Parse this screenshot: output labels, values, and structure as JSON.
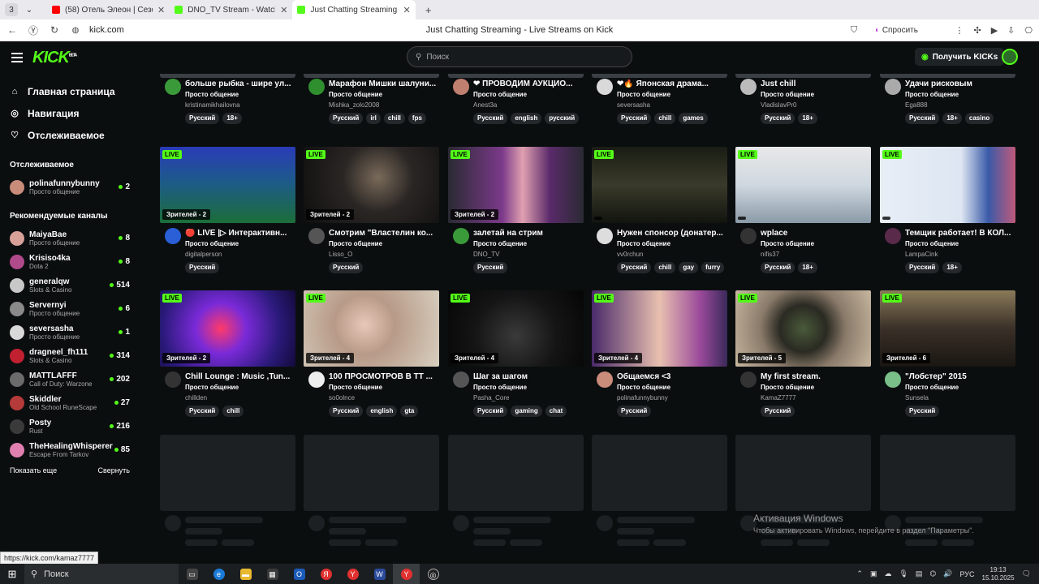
{
  "browser": {
    "tab_count": "3",
    "tabs": [
      {
        "label": "(58) Отель Элеон | Сезон",
        "fav": "#ff0000",
        "active": false
      },
      {
        "label": "DNO_TV Stream - Watch l",
        "fav": "#53fc18",
        "active": false
      },
      {
        "label": "Just Chatting Streaming",
        "fav": "#53fc18",
        "active": true
      }
    ],
    "url": "kick.com",
    "page_title": "Just Chatting Streaming - Live Streams on Kick",
    "ask_label": "Спросить"
  },
  "header": {
    "logo": "KICK",
    "logo_beta": "BETA",
    "search_placeholder": "Поиск",
    "kicks_label": "Получить KICKs"
  },
  "sidebar": {
    "nav": [
      {
        "icon": "⌂",
        "label": "Главная страница",
        "name": "home"
      },
      {
        "icon": "◎",
        "label": "Навигация",
        "name": "browse"
      },
      {
        "icon": "♡",
        "label": "Отслеживаемое",
        "name": "following"
      }
    ],
    "following_heading": "Отслеживаемое",
    "following": [
      {
        "name": "polinafunnybunny",
        "category": "Просто общение",
        "viewers": "2",
        "color": "#c98b7a"
      }
    ],
    "recommended_heading": "Рекомендуемые каналы",
    "recommended": [
      {
        "name": "MaiyaBae",
        "category": "Просто общение",
        "viewers": "8",
        "color": "#d7a19a"
      },
      {
        "name": "Krisiso4ka",
        "category": "Dota 2",
        "viewers": "8",
        "color": "#b04a8a"
      },
      {
        "name": "generalqw",
        "category": "Slots & Casino",
        "viewers": "514",
        "color": "#c8c8c8"
      },
      {
        "name": "Servernyi",
        "category": "Просто общение",
        "viewers": "6",
        "color": "#8a8a8a"
      },
      {
        "name": "seversasha",
        "category": "Просто общение",
        "viewers": "1",
        "color": "#d9d9d9"
      },
      {
        "name": "dragneel_fh111",
        "category": "Slots & Casino",
        "viewers": "314",
        "color": "#c02030"
      },
      {
        "name": "MATTLAFFF",
        "category": "Call of Duty: Warzone",
        "viewers": "202",
        "color": "#6b6b6b"
      },
      {
        "name": "Skiddler",
        "category": "Old School RuneScape",
        "viewers": "27",
        "color": "#b53a3a"
      },
      {
        "name": "Posty",
        "category": "Rust",
        "viewers": "216",
        "color": "#3a3a3a"
      },
      {
        "name": "TheHealingWhisperer",
        "category": "Escape From Tarkov",
        "viewers": "85",
        "color": "#e080b0"
      }
    ],
    "show_more": "Показать еще",
    "collapse": "Свернуть"
  },
  "top_row": [
    {
      "title": "больше рыбка - шире ул...",
      "category": "Просто общение",
      "streamer": "kristinamikhailovna",
      "tags": [
        "Русский",
        "18+"
      ],
      "av": "#3a9a3a"
    },
    {
      "title": "Марафон Мишки шалуни...",
      "category": "Просто общение",
      "streamer": "Mishka_zolo2008",
      "tags": [
        "Русский",
        "irl",
        "chill",
        "fps"
      ],
      "av": "#2f8f2f"
    },
    {
      "title": "❤ ПРОВОДИМ АУКЦИО...",
      "category": "Просто общение",
      "streamer": "Anest3a",
      "tags": [
        "Русский",
        "english",
        "русский"
      ],
      "av": "#c08070"
    },
    {
      "title": "❤🔥 Японская драма...",
      "category": "Просто общение",
      "streamer": "seversasha",
      "tags": [
        "Русский",
        "chill",
        "games"
      ],
      "av": "#d9d9d9"
    },
    {
      "title": "Just chill",
      "category": "Просто общение",
      "streamer": "VladislavPr0",
      "tags": [
        "Русский",
        "18+"
      ],
      "av": "#bbbbbb"
    },
    {
      "title": "Удачи рисковым",
      "category": "Просто общение",
      "streamer": "Ega888",
      "tags": [
        "Русский",
        "18+",
        "casino"
      ],
      "av": "#aaaaaa"
    }
  ],
  "row2": [
    {
      "title": "🔴 LIVE |▷ Интерактивн...",
      "category": "Просто общение",
      "streamer": "digitalperson",
      "tags": [
        "Русский"
      ],
      "viewers": "Зрителей - 2",
      "av": "#2a5fd8",
      "thumb": "linear-gradient(180deg,#2a3bb8 0%,#1d5a8a 45%,#1c6e3a 100%)"
    },
    {
      "title": "Смотрим \"Властелин ко...",
      "category": "Просто общение",
      "streamer": "Lisso_O",
      "tags": [
        "Русский"
      ],
      "viewers": "Зрителей - 2",
      "av": "#555555",
      "thumb": "radial-gradient(circle at 55% 40%,#7a6a5a 0%,#2a2624 40%,#0e0e0e 100%)"
    },
    {
      "title": "залетай на стрим",
      "category": "Просто общение",
      "streamer": "DNO_TV",
      "tags": [
        "Русский"
      ],
      "viewers": "Зрителей - 2",
      "av": "#3a9a3a",
      "thumb": "linear-gradient(90deg,#2a2a33 0%,#7b3a8a 40%,#e0a0b0 55%,#5a2a6a 75%,#2a2a33 100%)"
    },
    {
      "title": "Нужен спонсор (донатер...",
      "category": "Просто общение",
      "streamer": "vv0rchun",
      "tags": [
        "Русский",
        "chill",
        "gay",
        "furry"
      ],
      "av": "#dddddd",
      "thumb": "linear-gradient(180deg,#1a1d14 0%,#3a3a2a 50%,#12140f 100%)"
    },
    {
      "title": "wplace",
      "category": "Просто общение",
      "streamer": "nifis37",
      "tags": [
        "Русский",
        "18+"
      ],
      "av": "#333333",
      "thumb": "linear-gradient(180deg,#e8e8e8 0%,#cfd8e0 50%,#8a9aa8 100%)"
    },
    {
      "title": "Темщик работает! В КОЛ...",
      "category": "Просто общение",
      "streamer": "LampaCink",
      "tags": [
        "Русский",
        "18+"
      ],
      "av": "#5a2a4a",
      "thumb": "linear-gradient(90deg,#e8eef6 0%,#dde6f2 60%,#3a5aa8 80%,#c05a7a 100%)"
    }
  ],
  "row3": [
    {
      "title": "Chill Lounge : Music ,Tun...",
      "category": "Просто общение",
      "streamer": "chillden",
      "tags": [
        "Русский",
        "chill"
      ],
      "viewers": "Зрителей - 2",
      "av": "#333333",
      "thumb": "radial-gradient(circle at 45% 50%,#ff3a6a 0%,#7a2ad8 30%,#2a1a7a 70%,#140a3a 100%)"
    },
    {
      "title": "100 ПРОСМОТРОВ В ТТ ...",
      "category": "Просто общение",
      "streamer": "so0olnce",
      "tags": [
        "Русский",
        "english",
        "gta"
      ],
      "viewers": "Зрителей - 4",
      "av": "#eeeeee",
      "thumb": "radial-gradient(circle at 45% 45%,#e8c8b8 0%,#b89a88 35%,#d8d0c0 100%)"
    },
    {
      "title": "Шаг за шагом",
      "category": "Просто общение",
      "streamer": "Pasha_Core",
      "tags": [
        "Русский",
        "gaming",
        "chat"
      ],
      "viewers": "Зрителей - 4",
      "av": "#555555",
      "thumb": "radial-gradient(circle at 50% 60%,#3a3a3a 0%,#151515 50%,#050505 100%)"
    },
    {
      "title": "Общаемся <3",
      "category": "Просто общение",
      "streamer": "polinafunnybunny",
      "tags": [
        "Русский"
      ],
      "viewers": "Зрителей - 4",
      "av": "#c98b7a",
      "thumb": "linear-gradient(90deg,#4a2a6a 0%,#e8c0b0 50%,#9a4a9a 80%,#3a2a5a 100%)"
    },
    {
      "title": "My first stream.",
      "category": "Просто общение",
      "streamer": "KamaZ7777",
      "tags": [
        "Русский"
      ],
      "viewers": "Зрителей - 5",
      "av": "#333333",
      "thumb": "radial-gradient(circle at 50% 50%,#4a5a3a 0%,#2a2a22 30%,#8a7a6a 55%,#c8b8a0 100%)"
    },
    {
      "title": "\"Лобстер\" 2015",
      "category": "Просто общение",
      "streamer": "Sunsela",
      "tags": [
        "Русский"
      ],
      "viewers": "Зрителей - 6",
      "av": "#7abf8a",
      "thumb": "linear-gradient(180deg,#8a7a5a 0%,#3a3028 50%,#1a1612 100%)"
    }
  ],
  "live_label": "LIVE",
  "activation": {
    "title": "Активация Windows",
    "subtitle": "Чтобы активировать Windows, перейдите в раздел \"Параметры\"."
  },
  "status_url": "https://kick.com/kamaz7777",
  "taskbar": {
    "search": "Поиск",
    "lang": "РУС",
    "time": "19:13",
    "date": "15.10.2025"
  }
}
